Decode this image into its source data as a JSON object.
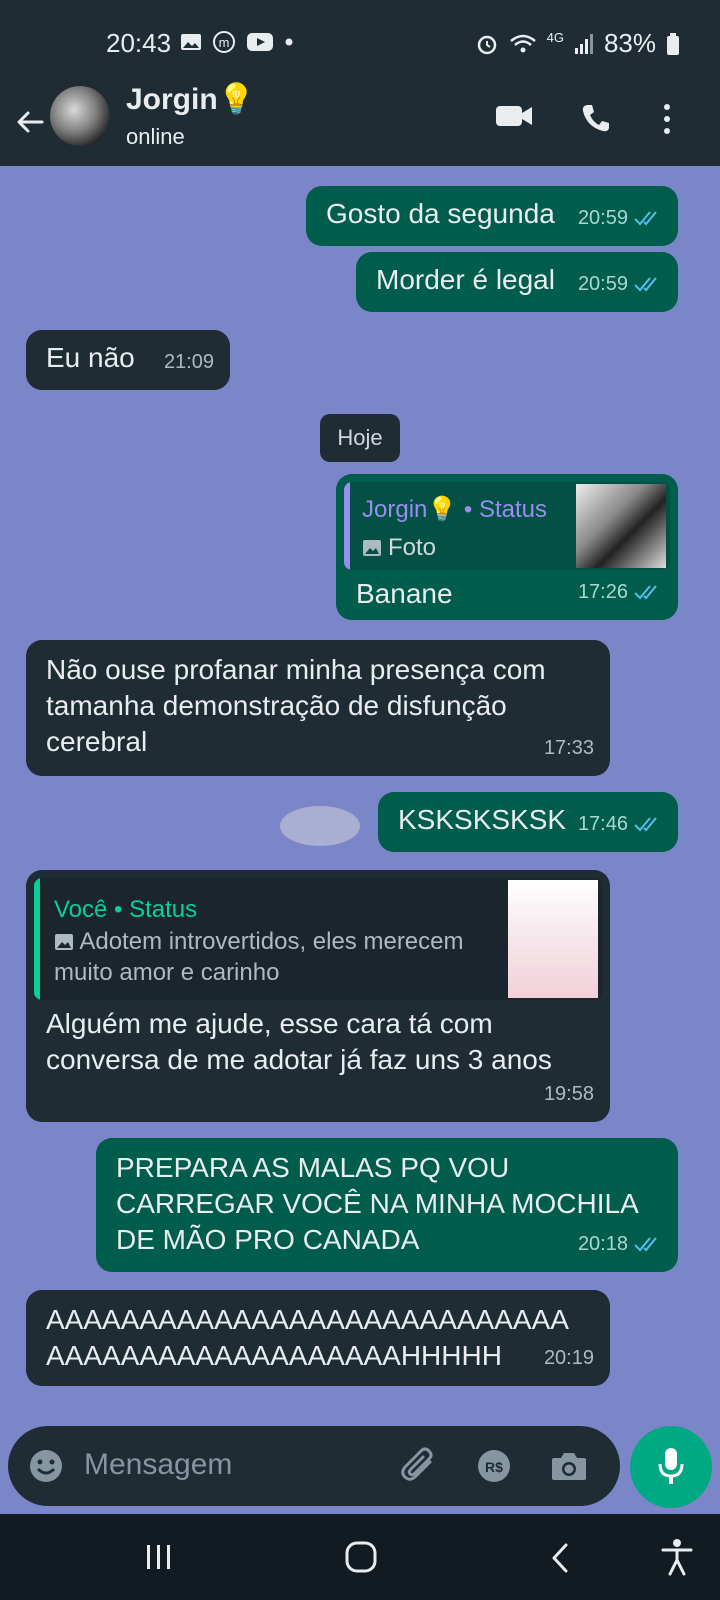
{
  "status_bar": {
    "time": "20:43",
    "network": "4G",
    "battery": "83%"
  },
  "header": {
    "name": "Jorgin💡",
    "presence": "online"
  },
  "date_chip": "Hoje",
  "messages": [
    {
      "text": "Gosto da segunda",
      "time": "20:59"
    },
    {
      "text": "Morder é legal",
      "time": "20:59"
    },
    {
      "text": "Eu não",
      "time": "21:09"
    },
    {
      "reply_to": "Jorgin💡 • Status",
      "reply_type": "Foto",
      "text": "Banane",
      "time": "17:26"
    },
    {
      "text": "Não ouse profanar minha presença com tamanha demonstração de disfunção cerebral",
      "time": "17:33"
    },
    {
      "text": "KSKSKSKSK",
      "time": "17:46"
    },
    {
      "reply_to": "Você • Status",
      "reply_snippet": "Adotem introvertidos, eles merecem muito amor e carinho",
      "text": "Alguém me ajude, esse cara tá com conversa de me adotar já faz uns 3 anos",
      "time": "19:58"
    },
    {
      "text": "PREPARA AS MALAS PQ VOU CARREGAR VOCÊ NA MINHA MOCHILA DE MÃO PRO CANADA",
      "time": "20:18"
    },
    {
      "text": "AAAAAAAAAAAAAAAAAAAAAAAAAAAAAAAAAAAAAAAAAAAAAAAHHHHH",
      "time": "20:19"
    }
  ],
  "composer": {
    "placeholder": "Mensagem"
  },
  "colors": {
    "chat_bg": "#7b86c9",
    "out_bubble": "#005c4b",
    "in_bubble": "#1f2c34",
    "accent": "#00a884",
    "ticks": "#53bdeb"
  }
}
